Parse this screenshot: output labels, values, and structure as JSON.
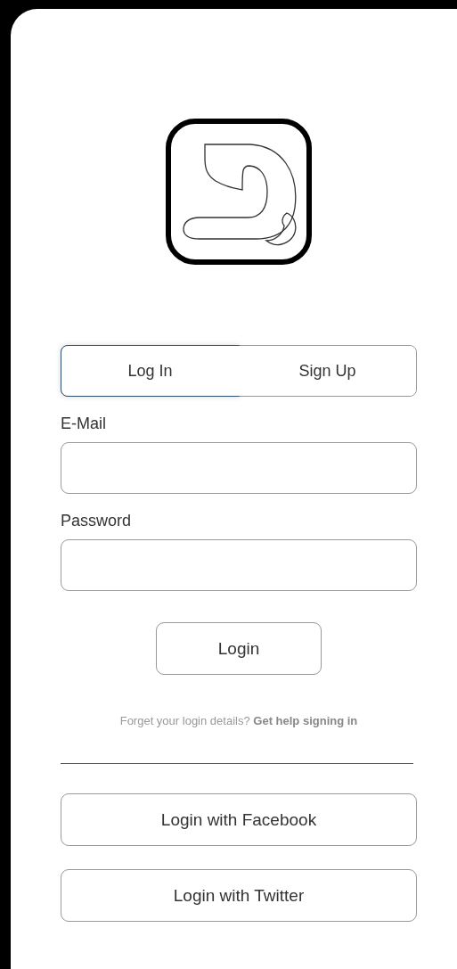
{
  "tabs": [
    {
      "label": "Log In",
      "selected": true
    },
    {
      "label": "Sign Up",
      "selected": false
    }
  ],
  "fields": [
    {
      "label": "E-Mail"
    },
    {
      "label": "Password"
    }
  ],
  "login_button": "Login",
  "help": {
    "text": "Forget your login details?",
    "link": "Get help signing in"
  },
  "social_buttons": [
    "Login with Facebook",
    "Login with Twitter"
  ]
}
